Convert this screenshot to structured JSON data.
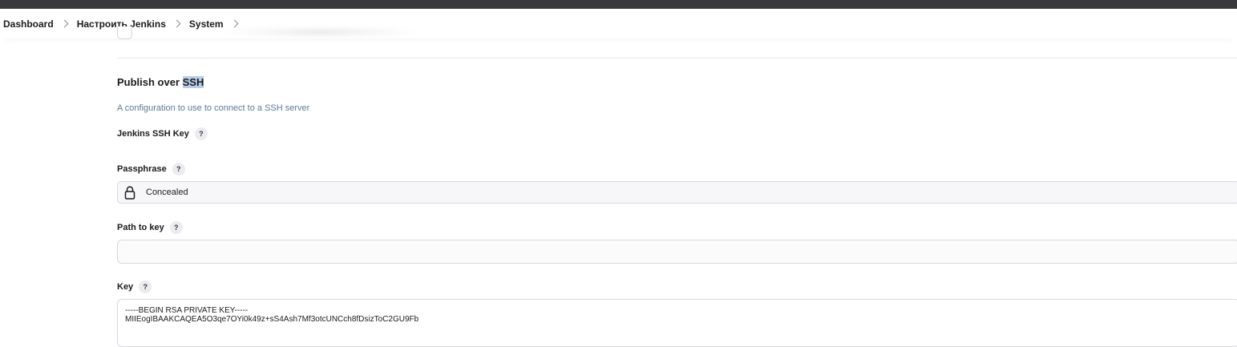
{
  "breadcrumbs": {
    "items": [
      "Dashboard",
      "Настроить Jenkins",
      "System"
    ]
  },
  "section": {
    "title_prefix": "Publish over ",
    "title_highlight": "SSH",
    "description": "A configuration to use to connect to a SSH server"
  },
  "fields": {
    "ssh_key": {
      "label": "Jenkins SSH Key",
      "help": "?"
    },
    "passphrase": {
      "label": "Passphrase",
      "help": "?",
      "value": "Concealed",
      "icon": "lock-icon"
    },
    "path_to_key": {
      "label": "Path to key",
      "help": "?",
      "value": ""
    },
    "key": {
      "label": "Key",
      "help": "?",
      "value": "-----BEGIN RSA PRIVATE KEY-----\nMIIEogIBAAKCAQEA5O3qe7OYi0k49z+sS4Ash7Mf3otcUNCch8fDsizToC2GU9Fb"
    }
  },
  "colors": {
    "topbar": "#3a3a3c",
    "description": "#5b7a95",
    "highlight": "#b9cde8"
  }
}
